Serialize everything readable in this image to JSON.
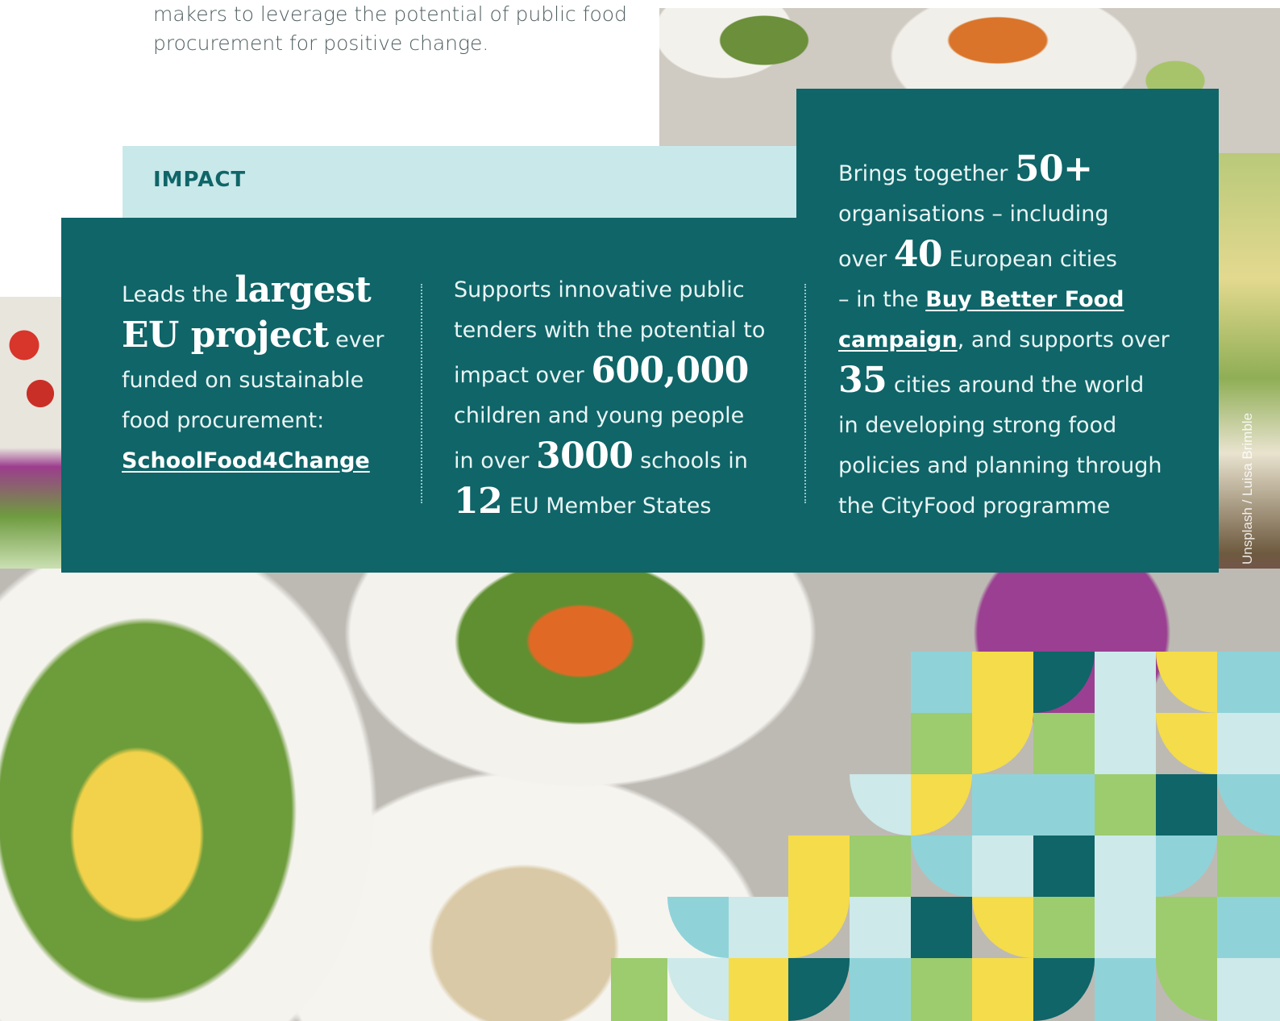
{
  "intro": {
    "line1": "makers to leverage the potential of public food",
    "line2": "procurement for positive change."
  },
  "impact": {
    "label": "IMPACT"
  },
  "columns": {
    "col1": {
      "pre": "Leads the",
      "big1": "largest",
      "big2": "EU project",
      "post1": "ever",
      "post2": "funded on sustainable",
      "post3": "food procurement:",
      "link": "SchoolFood4Change"
    },
    "col2": {
      "l1": "Supports innovative public",
      "l2": "tenders with the potential to",
      "l3": "impact over",
      "n1": "600,000",
      "l4": "children and young people",
      "l5": "in over",
      "n2": "3000",
      "l5b": "schools in",
      "n3": "12",
      "l6": "EU Member States"
    },
    "col3": {
      "l1": "Brings together",
      "n1": "50+",
      "l2": "organisations – including",
      "l3": "over",
      "n2": "40",
      "l3b": "European cities",
      "l4": "– in the",
      "link1": "Buy Better Food",
      "link2": "campaign",
      "l5": ", and supports over",
      "n3": "35",
      "l6": "cities around the world",
      "l7": "in developing strong food",
      "l8": "policies and planning through",
      "l9": "the CityFood programme"
    }
  },
  "photo_credit": "Unsplash / Luisa Brimble",
  "colors": {
    "teal": "#0f6568",
    "light_teal": "#c9e8ea",
    "pattern_yellow": "#f5dc4a",
    "pattern_green": "#9ccc6e",
    "pattern_aqua": "#8fd3d9",
    "pattern_pale": "#cde9ea"
  }
}
